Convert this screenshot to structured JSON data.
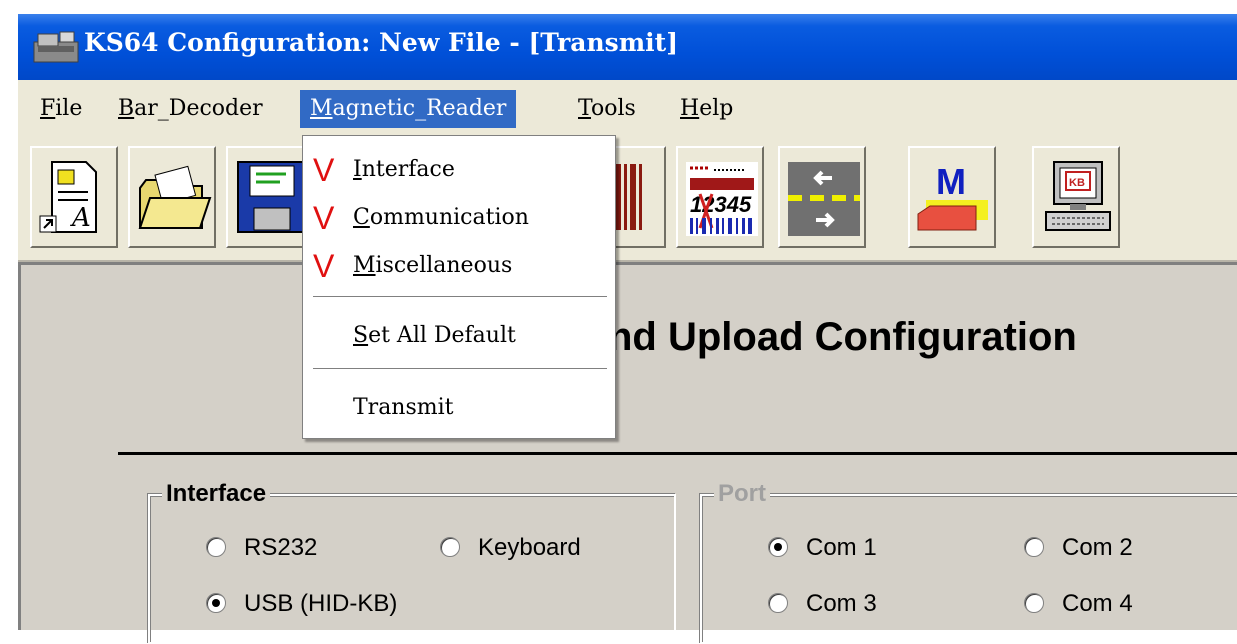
{
  "window": {
    "title": "KS64 Configuration: New File - [Transmit]"
  },
  "menubar": {
    "items": [
      {
        "label": "File"
      },
      {
        "label": "Bar_Decoder"
      },
      {
        "label": "Magnetic_Reader"
      },
      {
        "label": "Tools"
      },
      {
        "label": "Help"
      }
    ],
    "active": "Magnetic_Reader"
  },
  "toolbar": {
    "buttons": [
      {
        "icon": "new-file-icon"
      },
      {
        "icon": "open-folder-icon"
      },
      {
        "icon": "save-floppy-icon"
      },
      {
        "icon": "barcode-icon"
      },
      {
        "icon": "barcode-12345-icon"
      },
      {
        "icon": "arrows-transfer-icon"
      },
      {
        "icon": "magnetic-card-icon"
      },
      {
        "icon": "computer-keyboard-icon"
      }
    ],
    "barcode_text": "12345",
    "magnetic_letter": "M",
    "computer_label": "KB"
  },
  "dropdown": {
    "items": [
      {
        "label": "Interface",
        "checked": true
      },
      {
        "label": "Communication",
        "checked": true
      },
      {
        "label": "Miscellaneous",
        "checked": true
      },
      {
        "label": "Set All Default",
        "checked": false
      },
      {
        "label": "Transmit",
        "checked": false
      }
    ],
    "check_mark": "V"
  },
  "main": {
    "heading": "nd Upload Configuration"
  },
  "interface_group": {
    "legend": "Interface",
    "options": [
      {
        "label": "RS232",
        "checked": false
      },
      {
        "label": "Keyboard",
        "checked": false
      },
      {
        "label": "USB (HID-KB)",
        "checked": true
      }
    ]
  },
  "port_group": {
    "legend": "Port",
    "options": [
      {
        "label": "Com 1",
        "checked": true
      },
      {
        "label": "Com 2",
        "checked": false
      },
      {
        "label": "Com 3",
        "checked": false
      },
      {
        "label": "Com 4",
        "checked": false
      }
    ]
  },
  "colors": {
    "titlebar": "#0050d8",
    "menu_highlight": "#316ac5",
    "check_mark": "#e01010"
  }
}
